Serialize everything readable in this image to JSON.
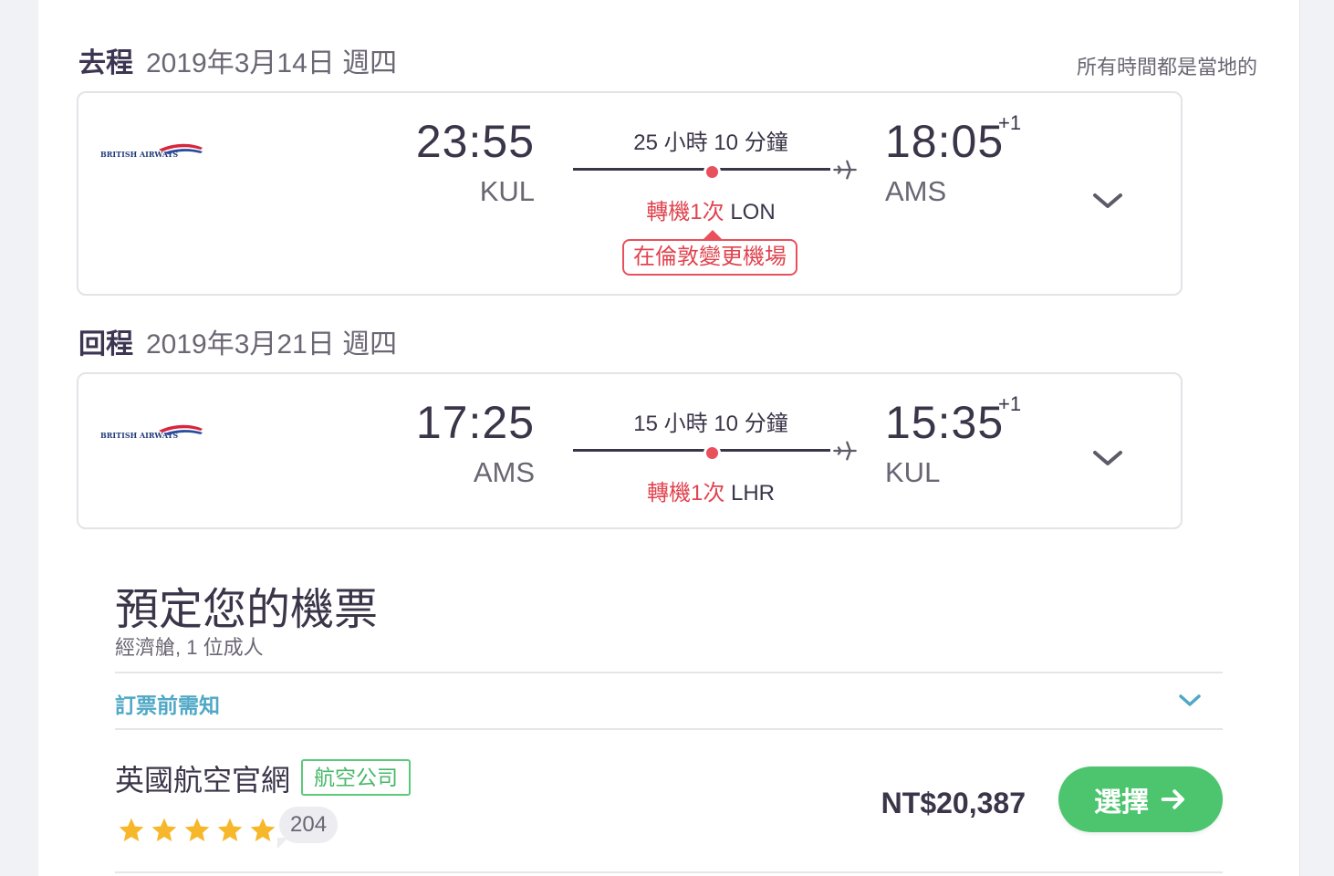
{
  "outbound": {
    "type": "去程",
    "date": "2019年3月14日 週四",
    "local_time_note": "所有時間都是當地的",
    "airline_logo": "british-airways-logo",
    "dep_time": "23:55",
    "dep_code": "KUL",
    "duration": "25 小時 10 分鐘",
    "stops": "轉機1次",
    "stop_city": "LON",
    "warning": "在倫敦變更機場",
    "arr_time": "18:05",
    "arr_day_offset": "+1",
    "arr_code": "AMS"
  },
  "return": {
    "type": "回程",
    "date": "2019年3月21日 週四",
    "airline_logo": "british-airways-logo",
    "dep_time": "17:25",
    "dep_code": "AMS",
    "duration": "15 小時 10 分鐘",
    "stops": "轉機1次",
    "stop_city": "LHR",
    "arr_time": "15:35",
    "arr_day_offset": "+1",
    "arr_code": "KUL"
  },
  "booking": {
    "title": "預定您的機票",
    "subtitle": "經濟艙, 1 位成人",
    "notice_label": "訂票前需知",
    "provider_name": "英國航空官網",
    "provider_tag": "航空公司",
    "rating_stars": 5,
    "review_count": "204",
    "price": "NT$20,387",
    "select_label": "選擇"
  },
  "colors": {
    "accent_green": "#4cc56e",
    "stop_red": "#e0444f",
    "notice_blue": "#4fa8c6",
    "star_yellow": "#f7b72a"
  }
}
